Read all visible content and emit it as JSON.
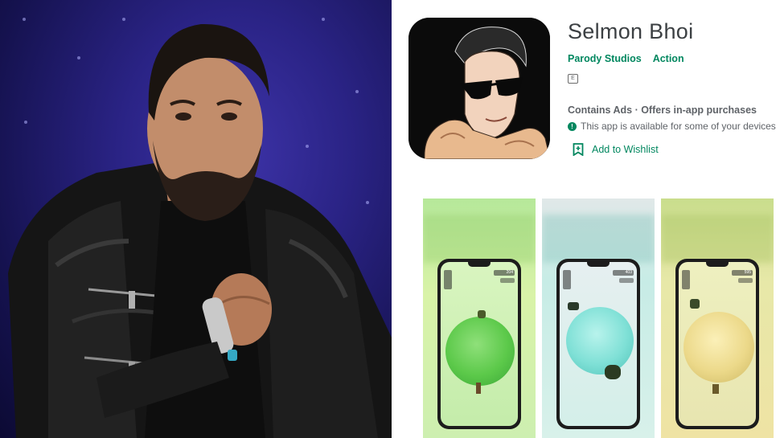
{
  "app": {
    "title": "Selmon Bhoi",
    "developer": "Parody Studios",
    "genre": "Action",
    "age_badge": "E",
    "monetization": "Contains Ads · Offers in-app purchases",
    "availability": "This app is available for some of your devices",
    "wishlist_label": "Add to Wishlist"
  },
  "screenshots": [
    {
      "label": "screenshot-1",
      "score": "204",
      "theme": "green"
    },
    {
      "label": "screenshot-2",
      "score": "403",
      "theme": "teal"
    },
    {
      "label": "screenshot-3",
      "score": "595",
      "theme": "yellow"
    }
  ],
  "colors": {
    "accent_green": "#01875f",
    "title_text": "#3c4043",
    "meta_text": "#5f6368",
    "photo_bg": "#2a2385"
  },
  "icons": {
    "info": "info-icon",
    "wishlist": "bookmark-add-icon",
    "age": "rating-badge-icon"
  }
}
